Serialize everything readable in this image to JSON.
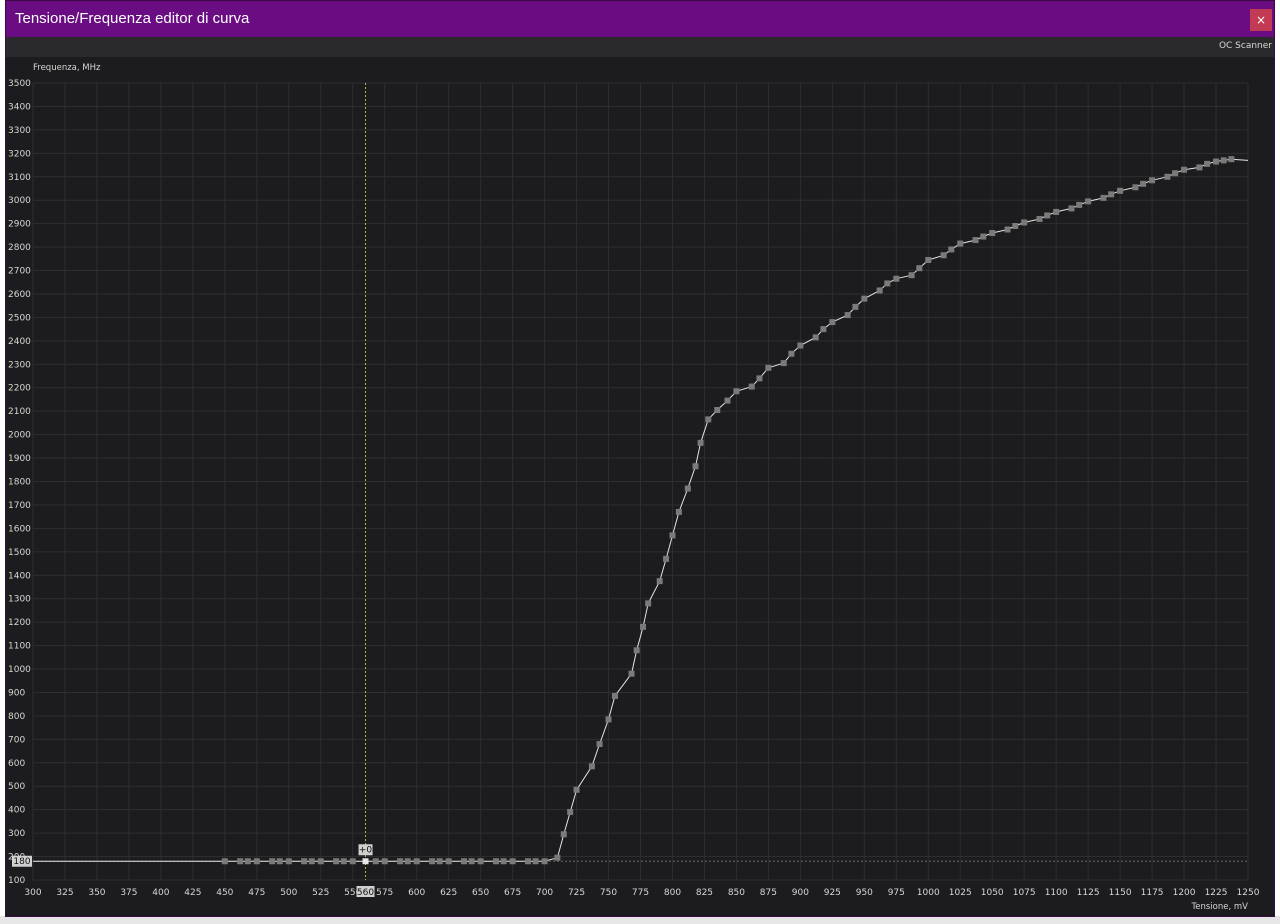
{
  "window": {
    "title": "Tensione/Frequenza editor di curva",
    "close_label": "×",
    "toolbar_button": "OC Scanner"
  },
  "colors": {
    "titlebar": "#6a0d83",
    "close_button": "#c33a55",
    "plot_background": "#1c1c1e",
    "curve": "#e6e6e6",
    "point": "#7a7a7a",
    "cursor_line": "#b5b83a"
  },
  "cursor": {
    "voltage_label": "560",
    "frequency_label": "180",
    "offset_label": "+0"
  },
  "chart_data": {
    "type": "line",
    "title": "",
    "xlabel": "Tensione, mV",
    "ylabel": "Frequenza, MHz",
    "xlim": [
      300,
      1250
    ],
    "ylim": [
      100,
      3500
    ],
    "grid": true,
    "x_ticks": [
      "300",
      "325",
      "350",
      "375",
      "400",
      "425",
      "450",
      "475",
      "500",
      "525",
      "550",
      "575",
      "600",
      "625",
      "650",
      "675",
      "700",
      "725",
      "750",
      "775",
      "800",
      "825",
      "850",
      "875",
      "900",
      "925",
      "950",
      "975",
      "1000",
      "1025",
      "1050",
      "1075",
      "1100",
      "1125",
      "1150",
      "1175",
      "1200",
      "1225",
      "1250"
    ],
    "y_ticks": [
      "100",
      "200",
      "300",
      "400",
      "500",
      "600",
      "700",
      "800",
      "900",
      "1000",
      "1100",
      "1200",
      "1300",
      "1400",
      "1500",
      "1600",
      "1700",
      "1800",
      "1900",
      "2000",
      "2100",
      "2200",
      "2300",
      "2400",
      "2500",
      "2600",
      "2700",
      "2800",
      "2900",
      "3000",
      "3100",
      "3200",
      "3300",
      "3400",
      "3500"
    ],
    "points": [
      [
        450,
        180
      ],
      [
        462,
        180
      ],
      [
        468,
        180
      ],
      [
        475,
        180
      ],
      [
        487,
        180
      ],
      [
        493,
        180
      ],
      [
        500,
        180
      ],
      [
        512,
        180
      ],
      [
        518,
        180
      ],
      [
        525,
        180
      ],
      [
        537,
        180
      ],
      [
        543,
        180
      ],
      [
        550,
        180
      ],
      [
        560,
        180
      ],
      [
        568,
        180
      ],
      [
        575,
        180
      ],
      [
        587,
        180
      ],
      [
        593,
        180
      ],
      [
        600,
        180
      ],
      [
        612,
        180
      ],
      [
        618,
        180
      ],
      [
        625,
        180
      ],
      [
        637,
        180
      ],
      [
        643,
        180
      ],
      [
        650,
        180
      ],
      [
        662,
        180
      ],
      [
        668,
        180
      ],
      [
        675,
        180
      ],
      [
        687,
        180
      ],
      [
        693,
        180
      ],
      [
        700,
        180
      ],
      [
        710,
        195
      ],
      [
        715,
        295
      ],
      [
        720,
        390
      ],
      [
        725,
        485
      ],
      [
        737,
        585
      ],
      [
        743,
        680
      ],
      [
        750,
        785
      ],
      [
        755,
        885
      ],
      [
        768,
        980
      ],
      [
        772,
        1080
      ],
      [
        777,
        1180
      ],
      [
        781,
        1280
      ],
      [
        790,
        1375
      ],
      [
        795,
        1470
      ],
      [
        800,
        1570
      ],
      [
        805,
        1670
      ],
      [
        812,
        1770
      ],
      [
        818,
        1865
      ],
      [
        822,
        1965
      ],
      [
        828,
        2065
      ],
      [
        835,
        2105
      ],
      [
        843,
        2145
      ],
      [
        850,
        2185
      ],
      [
        862,
        2205
      ],
      [
        868,
        2240
      ],
      [
        875,
        2285
      ],
      [
        887,
        2305
      ],
      [
        893,
        2345
      ],
      [
        900,
        2380
      ],
      [
        912,
        2415
      ],
      [
        918,
        2450
      ],
      [
        925,
        2480
      ],
      [
        937,
        2510
      ],
      [
        943,
        2545
      ],
      [
        950,
        2580
      ],
      [
        962,
        2615
      ],
      [
        968,
        2645
      ],
      [
        975,
        2665
      ],
      [
        987,
        2680
      ],
      [
        993,
        2710
      ],
      [
        1000,
        2745
      ],
      [
        1012,
        2765
      ],
      [
        1018,
        2790
      ],
      [
        1025,
        2815
      ],
      [
        1037,
        2830
      ],
      [
        1043,
        2845
      ],
      [
        1050,
        2860
      ],
      [
        1062,
        2875
      ],
      [
        1068,
        2890
      ],
      [
        1075,
        2905
      ],
      [
        1087,
        2920
      ],
      [
        1093,
        2935
      ],
      [
        1100,
        2950
      ],
      [
        1112,
        2965
      ],
      [
        1118,
        2980
      ],
      [
        1125,
        2995
      ],
      [
        1137,
        3010
      ],
      [
        1143,
        3025
      ],
      [
        1150,
        3040
      ],
      [
        1162,
        3055
      ],
      [
        1168,
        3070
      ],
      [
        1175,
        3085
      ],
      [
        1187,
        3100
      ],
      [
        1193,
        3115
      ],
      [
        1200,
        3130
      ],
      [
        1212,
        3140
      ],
      [
        1218,
        3155
      ],
      [
        1225,
        3165
      ],
      [
        1231,
        3170
      ],
      [
        1237,
        3175
      ]
    ],
    "curve_start": [
      300,
      180
    ],
    "curve_end": [
      1250,
      3170
    ]
  }
}
